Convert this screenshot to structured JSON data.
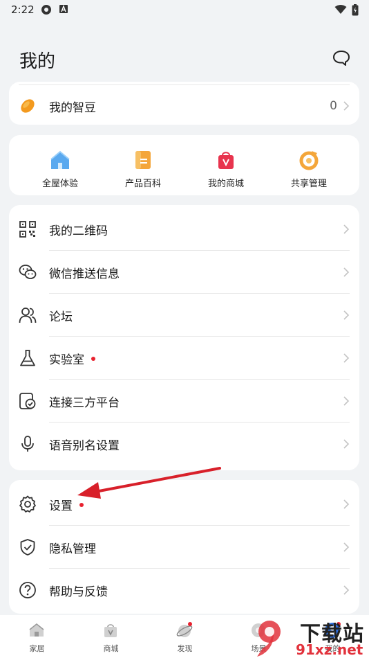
{
  "status_bar": {
    "time": "2:22"
  },
  "header": {
    "title": "我的"
  },
  "bean": {
    "label": "我的智豆",
    "value": "0"
  },
  "quick_actions": [
    {
      "label": "全屋体验",
      "icon": "house-icon",
      "color": "#5aa9ef"
    },
    {
      "label": "产品百科",
      "icon": "book-icon",
      "color": "#f4a63a"
    },
    {
      "label": "我的商城",
      "icon": "shopping-bag-icon",
      "color": "#e8344e"
    },
    {
      "label": "共享管理",
      "icon": "share-icon",
      "color": "#f4a63a"
    }
  ],
  "menu": [
    {
      "label": "我的二维码",
      "icon": "qr-code-icon",
      "dot": false
    },
    {
      "label": "微信推送信息",
      "icon": "wechat-icon",
      "dot": false
    },
    {
      "label": "论坛",
      "icon": "users-icon",
      "dot": false
    },
    {
      "label": "实验室",
      "icon": "flask-icon",
      "dot": true
    },
    {
      "label": "连接三方平台",
      "icon": "third-party-icon",
      "dot": false
    },
    {
      "label": "语音别名设置",
      "icon": "microphone-icon",
      "dot": false
    }
  ],
  "settings_menu": [
    {
      "label": "设置",
      "icon": "gear-icon",
      "dot": true
    },
    {
      "label": "隐私管理",
      "icon": "shield-icon",
      "dot": false
    },
    {
      "label": "帮助与反馈",
      "icon": "help-icon",
      "dot": false
    }
  ],
  "bottom_nav": [
    {
      "label": "家居",
      "icon": "home-icon"
    },
    {
      "label": "商城",
      "icon": "store-icon"
    },
    {
      "label": "发现",
      "icon": "planet-icon"
    },
    {
      "label": "场景",
      "icon": "scene-icon"
    },
    {
      "label": "我的",
      "icon": "profile-icon"
    }
  ],
  "watermark": {
    "text": "下载站",
    "site": "91xz.net"
  },
  "colors": {
    "accent_red": "#e8222f",
    "arrow": "#d8202a"
  }
}
